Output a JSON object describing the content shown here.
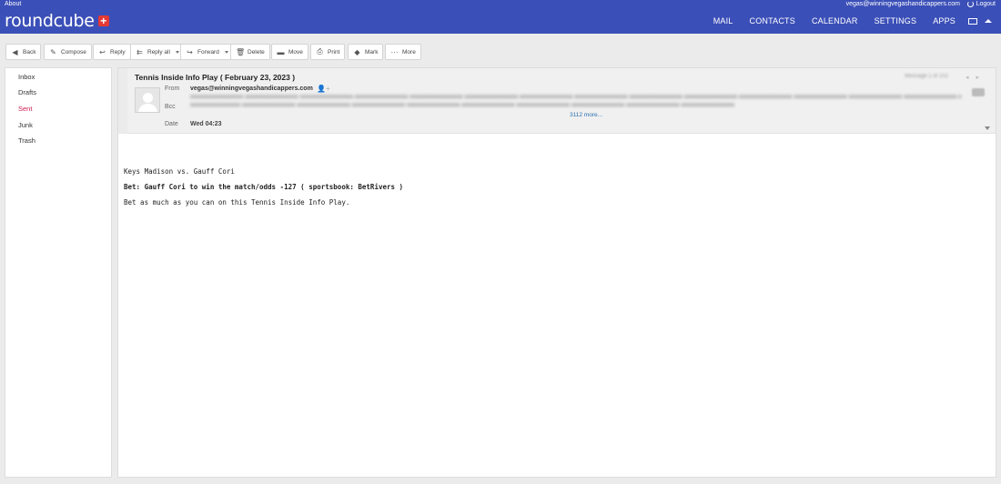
{
  "topbar": {
    "about": "About",
    "user_email": "vegas@winningvegashandicappers.com",
    "logout": "Logout",
    "logo": "roundcube",
    "nav": [
      "MAIL",
      "CONTACTS",
      "CALENDAR",
      "SETTINGS",
      "APPS"
    ]
  },
  "toolbar": {
    "back": "Back",
    "compose": "Compose",
    "reply": "Reply",
    "reply_all": "Reply all",
    "forward": "Forward",
    "delete": "Delete",
    "move": "Move",
    "print": "Print",
    "mark": "Mark",
    "more": "More"
  },
  "folders": [
    "Inbox",
    "Drafts",
    "Sent",
    "Junk",
    "Trash"
  ],
  "active_folder": "Sent",
  "message": {
    "subject": "Tennis Inside Info Play ( February 23, 2023 )",
    "from_label": "From",
    "from": "vegas@winningvegashandicappers.com",
    "bcc_label": "Bcc",
    "bcc_more": "3112 more...",
    "date_label": "Date",
    "date": "Wed 04:23",
    "body": {
      "line1": "Keys Madison vs. Gauff Cori",
      "line2": "Bet: Gauff Cori to win the match/odds -127 ( sportsbook: BetRivers )",
      "line3": "Bet as much as you can on this Tennis Inside Info Play."
    }
  },
  "colors": {
    "topbar": "#3b4fb8",
    "active_folder": "#d11a4f",
    "link": "#2a6fb0",
    "logo_plus": "#e53935"
  }
}
